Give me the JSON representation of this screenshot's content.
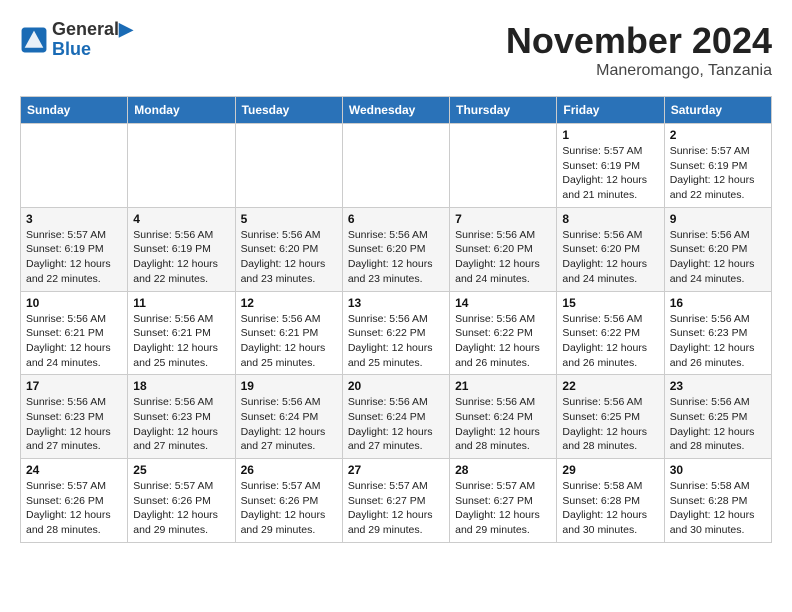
{
  "logo": {
    "line1": "General",
    "line2": "Blue"
  },
  "title": "November 2024",
  "subtitle": "Maneromango, Tanzania",
  "weekdays": [
    "Sunday",
    "Monday",
    "Tuesday",
    "Wednesday",
    "Thursday",
    "Friday",
    "Saturday"
  ],
  "weeks": [
    [
      {
        "day": "",
        "info": ""
      },
      {
        "day": "",
        "info": ""
      },
      {
        "day": "",
        "info": ""
      },
      {
        "day": "",
        "info": ""
      },
      {
        "day": "",
        "info": ""
      },
      {
        "day": "1",
        "info": "Sunrise: 5:57 AM\nSunset: 6:19 PM\nDaylight: 12 hours and 21 minutes."
      },
      {
        "day": "2",
        "info": "Sunrise: 5:57 AM\nSunset: 6:19 PM\nDaylight: 12 hours and 22 minutes."
      }
    ],
    [
      {
        "day": "3",
        "info": "Sunrise: 5:57 AM\nSunset: 6:19 PM\nDaylight: 12 hours and 22 minutes."
      },
      {
        "day": "4",
        "info": "Sunrise: 5:56 AM\nSunset: 6:19 PM\nDaylight: 12 hours and 22 minutes."
      },
      {
        "day": "5",
        "info": "Sunrise: 5:56 AM\nSunset: 6:20 PM\nDaylight: 12 hours and 23 minutes."
      },
      {
        "day": "6",
        "info": "Sunrise: 5:56 AM\nSunset: 6:20 PM\nDaylight: 12 hours and 23 minutes."
      },
      {
        "day": "7",
        "info": "Sunrise: 5:56 AM\nSunset: 6:20 PM\nDaylight: 12 hours and 24 minutes."
      },
      {
        "day": "8",
        "info": "Sunrise: 5:56 AM\nSunset: 6:20 PM\nDaylight: 12 hours and 24 minutes."
      },
      {
        "day": "9",
        "info": "Sunrise: 5:56 AM\nSunset: 6:20 PM\nDaylight: 12 hours and 24 minutes."
      }
    ],
    [
      {
        "day": "10",
        "info": "Sunrise: 5:56 AM\nSunset: 6:21 PM\nDaylight: 12 hours and 24 minutes."
      },
      {
        "day": "11",
        "info": "Sunrise: 5:56 AM\nSunset: 6:21 PM\nDaylight: 12 hours and 25 minutes."
      },
      {
        "day": "12",
        "info": "Sunrise: 5:56 AM\nSunset: 6:21 PM\nDaylight: 12 hours and 25 minutes."
      },
      {
        "day": "13",
        "info": "Sunrise: 5:56 AM\nSunset: 6:22 PM\nDaylight: 12 hours and 25 minutes."
      },
      {
        "day": "14",
        "info": "Sunrise: 5:56 AM\nSunset: 6:22 PM\nDaylight: 12 hours and 26 minutes."
      },
      {
        "day": "15",
        "info": "Sunrise: 5:56 AM\nSunset: 6:22 PM\nDaylight: 12 hours and 26 minutes."
      },
      {
        "day": "16",
        "info": "Sunrise: 5:56 AM\nSunset: 6:23 PM\nDaylight: 12 hours and 26 minutes."
      }
    ],
    [
      {
        "day": "17",
        "info": "Sunrise: 5:56 AM\nSunset: 6:23 PM\nDaylight: 12 hours and 27 minutes."
      },
      {
        "day": "18",
        "info": "Sunrise: 5:56 AM\nSunset: 6:23 PM\nDaylight: 12 hours and 27 minutes."
      },
      {
        "day": "19",
        "info": "Sunrise: 5:56 AM\nSunset: 6:24 PM\nDaylight: 12 hours and 27 minutes."
      },
      {
        "day": "20",
        "info": "Sunrise: 5:56 AM\nSunset: 6:24 PM\nDaylight: 12 hours and 27 minutes."
      },
      {
        "day": "21",
        "info": "Sunrise: 5:56 AM\nSunset: 6:24 PM\nDaylight: 12 hours and 28 minutes."
      },
      {
        "day": "22",
        "info": "Sunrise: 5:56 AM\nSunset: 6:25 PM\nDaylight: 12 hours and 28 minutes."
      },
      {
        "day": "23",
        "info": "Sunrise: 5:56 AM\nSunset: 6:25 PM\nDaylight: 12 hours and 28 minutes."
      }
    ],
    [
      {
        "day": "24",
        "info": "Sunrise: 5:57 AM\nSunset: 6:26 PM\nDaylight: 12 hours and 28 minutes."
      },
      {
        "day": "25",
        "info": "Sunrise: 5:57 AM\nSunset: 6:26 PM\nDaylight: 12 hours and 29 minutes."
      },
      {
        "day": "26",
        "info": "Sunrise: 5:57 AM\nSunset: 6:26 PM\nDaylight: 12 hours and 29 minutes."
      },
      {
        "day": "27",
        "info": "Sunrise: 5:57 AM\nSunset: 6:27 PM\nDaylight: 12 hours and 29 minutes."
      },
      {
        "day": "28",
        "info": "Sunrise: 5:57 AM\nSunset: 6:27 PM\nDaylight: 12 hours and 29 minutes."
      },
      {
        "day": "29",
        "info": "Sunrise: 5:58 AM\nSunset: 6:28 PM\nDaylight: 12 hours and 30 minutes."
      },
      {
        "day": "30",
        "info": "Sunrise: 5:58 AM\nSunset: 6:28 PM\nDaylight: 12 hours and 30 minutes."
      }
    ]
  ]
}
